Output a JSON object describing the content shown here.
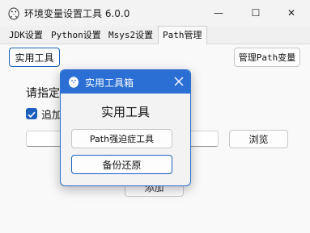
{
  "window": {
    "title": "环境变量设置工具 6.0.0",
    "app_icon": "penguin-icon",
    "minimize_glyph": "—",
    "maximize_glyph": "☐",
    "close_glyph": "✕"
  },
  "tabs": [
    {
      "label": "JDK设置",
      "active": false
    },
    {
      "label": "Python设置",
      "active": false
    },
    {
      "label": "Msys2设置",
      "active": false
    },
    {
      "label": "Path管理",
      "active": true
    }
  ],
  "panel": {
    "tools_button": "实用工具",
    "manage_path_button": "管理Path变量",
    "specify_label": "请指定",
    "append_label": "追加",
    "append_checked": true,
    "path_input_value": "",
    "browse_button": "浏览",
    "add_button": "添加"
  },
  "dialog": {
    "title": "实用工具箱",
    "heading": "实用工具",
    "path_ocd_button": "Path强迫症工具",
    "backup_button": "备份还原",
    "titlebar_color": "#2b6fd4"
  },
  "colors": {
    "accent": "#1d5fbf"
  }
}
